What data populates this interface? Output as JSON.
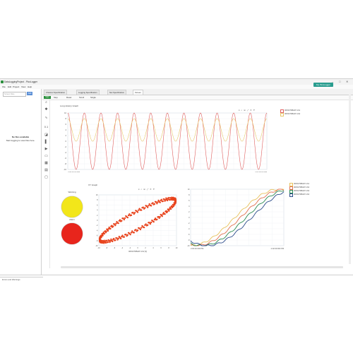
{
  "window": {
    "title": "DataLoggingProject - PicoLogger",
    "minimize": "–",
    "maximize": "□",
    "close": "✕"
  },
  "menu": [
    "File",
    "Edit",
    "Project",
    "View",
    "Help"
  ],
  "my_picologger_button": "My PicoLogger",
  "left_panel": {
    "input_placeholder": "Screen Files",
    "button": "Add",
    "empty_title": "No files available",
    "empty_text": "Start logging to view files here.",
    "footer": "Errors and Warnings"
  },
  "tabs": [
    "Channel Specification",
    "Logging Specification",
    "Net Specification",
    "Screen"
  ],
  "toolbar": {
    "start": "Start",
    "items": [
      "Stop",
      "Reset",
      "Scroll",
      "Single"
    ]
  },
  "strip_chart": {
    "title": "Long History Graph",
    "legend": [
      "IDXX27R5s07r.ch1",
      "IDXX27R5s07r.ch2"
    ],
    "x_start": "2:00:00:00 PM",
    "x_end": "2:02:00:00 PM"
  },
  "lamps": [
    {
      "label": "Warning",
      "color": "#f2e61a"
    },
    {
      "label": "Alarm",
      "color": "#e8251c"
    }
  ],
  "xy_chart": {
    "title": "XY Graph",
    "xlabel": "IDXX27R5s07r.ch1 [V]"
  },
  "multi_chart": {
    "legend": [
      "IDXX27R5s07r.ch1",
      "IDXX27R5s07r.ch2",
      "IDXX27R5s07r.ch3",
      "IDXX27R5s07r.ch4"
    ],
    "x_start": "2:00:00:000 PM",
    "x_end": "2:02:00:000 PM"
  },
  "chart_data": [
    {
      "type": "line",
      "title": "Long History Graph",
      "ylim": [
        -10,
        10
      ],
      "yticks": [
        10,
        8,
        6,
        4,
        2,
        0,
        -2,
        -4,
        -6,
        -8,
        -10
      ],
      "series": [
        {
          "name": "IDXX27R5s07r.ch1",
          "color": "#e06060",
          "amplitude": 10,
          "offset": 0,
          "cycles": 12
        },
        {
          "name": "IDXX27R5s07r.ch2",
          "color": "#e8c86a",
          "amplitude": 4,
          "offset": 4,
          "cycles": 12
        }
      ]
    },
    {
      "type": "scatter",
      "title": "XY Graph",
      "xlabel": "IDXX27R5s07r.ch1 [V]",
      "xlim": [
        -10,
        10
      ],
      "ylim": [
        -10,
        10
      ],
      "xticks": [
        -10,
        -8,
        -6,
        -4,
        -2,
        0,
        2,
        4,
        6,
        8,
        10
      ],
      "yticks": [
        10,
        8,
        6,
        4,
        2,
        0,
        -2,
        -4,
        -6,
        -8,
        -10
      ],
      "color": "#e8431c"
    },
    {
      "type": "line",
      "ylim": [
        -10,
        10
      ],
      "yticks": [
        10,
        8,
        6,
        4,
        2,
        0,
        -2,
        -4,
        -6,
        -8,
        -10
      ],
      "series": [
        {
          "name": "IDXX27R5s07r.ch1",
          "color": "#e8c25a",
          "phase": 0.0
        },
        {
          "name": "IDXX27R5s07r.ch2",
          "color": "#e07050",
          "phase": 0.06
        },
        {
          "name": "IDXX27R5s07r.ch3",
          "color": "#2a8a50",
          "phase": 0.12
        },
        {
          "name": "IDXX27R5s07r.ch4",
          "color": "#2a4a8a",
          "phase": 0.18
        }
      ]
    }
  ]
}
